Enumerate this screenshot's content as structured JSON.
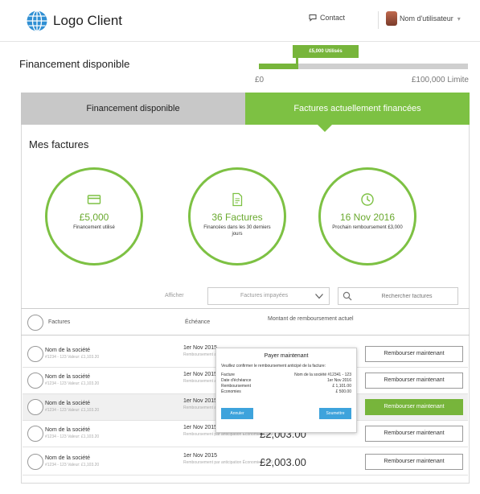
{
  "header": {
    "logo_text": "Logo Client",
    "contact_label": "Contact",
    "user_label": "Nom d'utilisateur"
  },
  "funding": {
    "title": "Financement disponible",
    "used_tag": "£5,000 Utilisés",
    "used_fraction": 0.19,
    "min_label": "£0",
    "max_label": "£100,000 Limite"
  },
  "tabs": [
    {
      "label": "Financement disponible",
      "active": false
    },
    {
      "label": "Factures actuellement financées",
      "active": true
    }
  ],
  "section_title": "Mes factures",
  "stats": [
    {
      "icon": "card-icon",
      "big": "£5,000",
      "small": "Financement utilisé"
    },
    {
      "icon": "invoice-icon",
      "big": "36 Factures",
      "small": "Financées dans les 30 derniers jours"
    },
    {
      "icon": "clock-icon",
      "big": "16 Nov 2016",
      "small": "Prochain remboursement £3,000"
    }
  ],
  "filter": {
    "label": "Afficher",
    "selected": "Factures impayées",
    "search_placeholder": "Rechercher factures"
  },
  "table": {
    "columns": [
      "Factures",
      "Échéance",
      "Montant de remboursement actuel"
    ],
    "rows": [
      {
        "company": "Nom de la société",
        "meta": "#1234 - 123 Valeur: £1,103.20",
        "due": "1er Nov 2015",
        "due_sub": "Remboursement anticipé Économies £400",
        "amount": "",
        "button": "Rembourser maintenant",
        "highlight": false,
        "alt": false
      },
      {
        "company": "Nom de la société",
        "meta": "#1234 - 123 Valeur: £1,103.20",
        "due": "1er Nov 2015",
        "due_sub": "Remboursement anticipé Économies £400",
        "amount": "",
        "button": "Rembourser maintenant",
        "highlight": false,
        "alt": false
      },
      {
        "company": "Nom de la société",
        "meta": "#1234 - 123 Valeur: £1,103.20",
        "due": "1er Nov 2015",
        "due_sub": "Remboursement anticipé Économies £400",
        "amount": "",
        "button": "Rembourser maintenant",
        "highlight": true,
        "alt": true
      },
      {
        "company": "Nom de la société",
        "meta": "#1234 - 123 Valeur: £1,103.20",
        "due": "1er Nov 2015",
        "due_sub": "Remboursement par anticipation Économies £100",
        "amount": "£2,003.00",
        "button": "Rembourser maintenant",
        "highlight": false,
        "alt": false
      },
      {
        "company": "Nom de la société",
        "meta": "#1234 - 123 Valeur: £1,103.20",
        "due": "1er Nov 2015",
        "due_sub": "Remboursement par anticipation Économies £100",
        "amount": "£2,003.00",
        "button": "Rembourser maintenant",
        "highlight": false,
        "alt": false
      }
    ]
  },
  "modal": {
    "title": "Payer maintenant",
    "description": "Veuillez confirmer le remboursement anticipé de la facture:",
    "fields": [
      {
        "label": "Facture",
        "value": "Nom de la société #12341 - 123"
      },
      {
        "label": "Date d'échéance",
        "value": "1er Nov 2016"
      },
      {
        "label": "Remboursement",
        "value": "£ 1,101.00"
      },
      {
        "label": "Économies",
        "value": "£ 500.00"
      }
    ],
    "cancel_label": "Annuler",
    "submit_label": "Soumettre"
  },
  "colors": {
    "accent": "#7dc143",
    "modal_button": "#3ea3dc"
  }
}
